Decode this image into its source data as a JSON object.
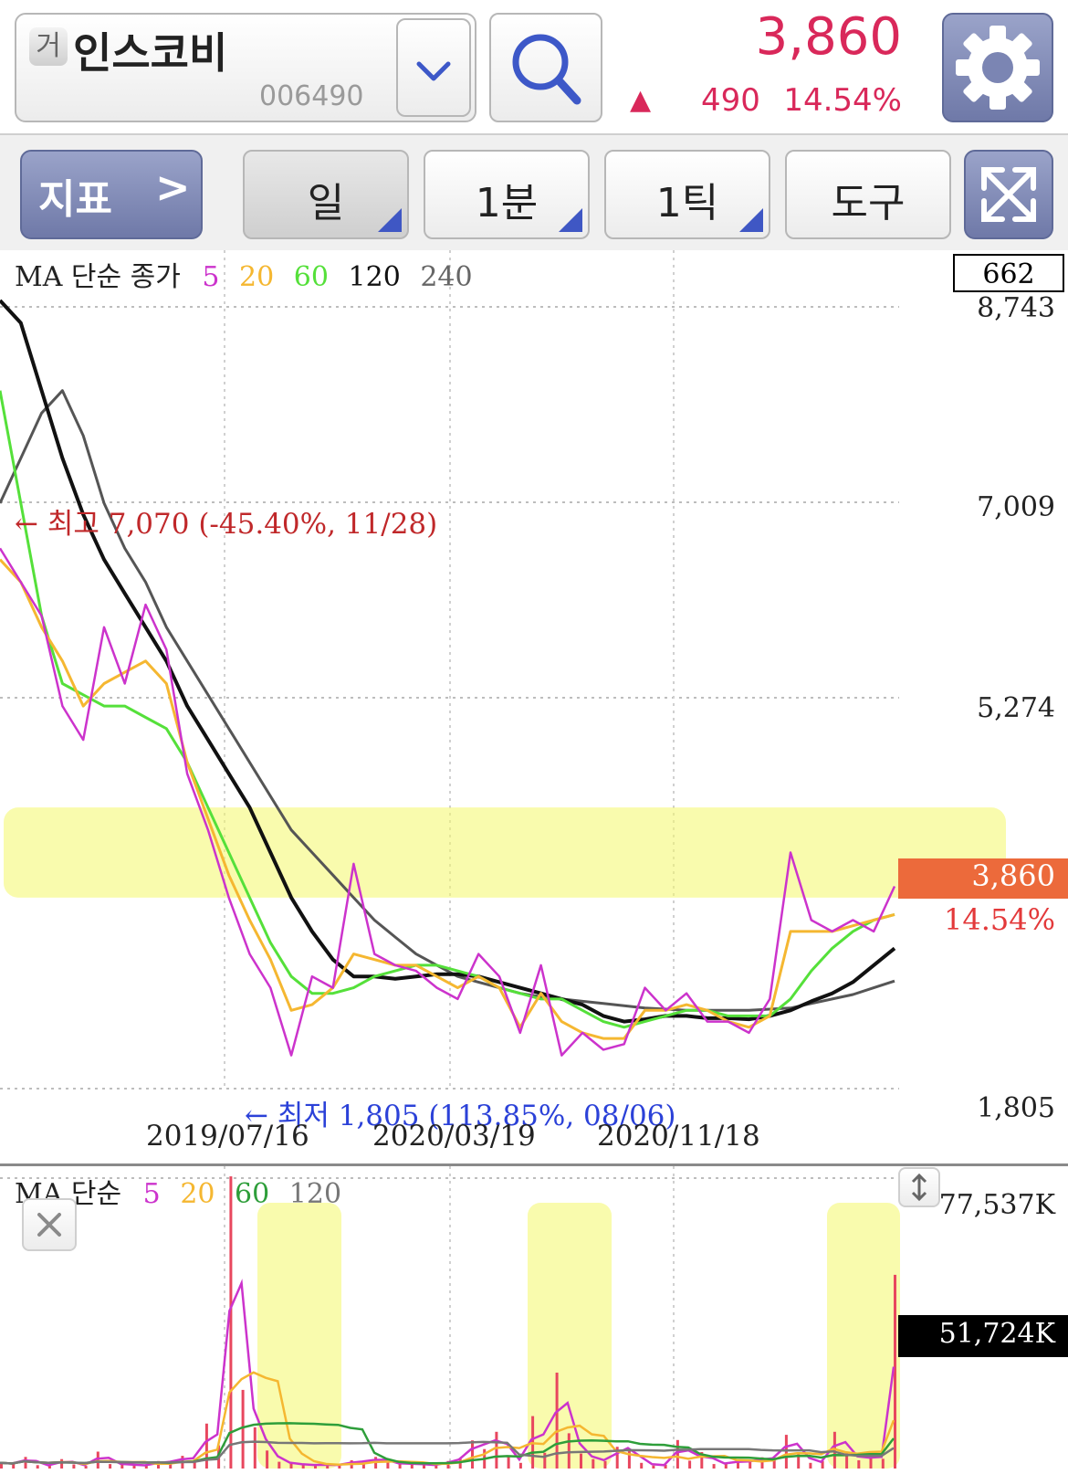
{
  "header": {
    "market_badge": "거",
    "stock_name": "인스코비",
    "stock_code": "006490",
    "price": "3,860",
    "change_arrow": "▲",
    "change": "490",
    "change_pct": "14.54%"
  },
  "toolbar": {
    "indicator_label": "지표",
    "indicator_chevron": ">",
    "period_day": "일",
    "period_minute": "1분",
    "period_tick": "1틱",
    "tools_label": "도구"
  },
  "icons": {
    "dropdown": "chevron-down-icon",
    "search": "search-icon",
    "settings": "gear-icon",
    "expand": "expand-icon",
    "close": "close-icon",
    "resize": "resize-icon"
  },
  "colors": {
    "up": "#d9285a",
    "ma5": "#cc33cc",
    "ma20": "#f5b731",
    "ma60": "#55e03a",
    "ma120": "#111111",
    "ma240": "#555555",
    "vol_ma60": "#2e9e3a",
    "vol_ma120": "#777777",
    "price_tag": "#ec6a3b",
    "highlight": "#f4f86a",
    "high_note": "#c0282a",
    "low_note": "#2b41d8"
  },
  "chart_data": [
    {
      "type": "line",
      "legend": {
        "prefix": "MA 단순 종가",
        "periods": [
          "5",
          "20",
          "60",
          "120",
          "240"
        ]
      },
      "x_tick_labels": [
        "2019/07/16",
        "2020/03/19",
        "2020/11/18"
      ],
      "y_tick_labels": [
        "8,743",
        "7,009",
        "5,274",
        "1,805"
      ],
      "ylim": [
        1805,
        8743
      ],
      "top_box_label": "662",
      "current_price_label": "3,860",
      "current_change_label": "14.54%",
      "annotations": {
        "high": "← 최고 7,070 (-45.40%, 11/28)",
        "low": "← 최저 1,805 (113.85%, 08/06)"
      },
      "highlight_band_price": [
        3500,
        4300
      ],
      "series": [
        {
          "name": "5",
          "values": [
            6600,
            6300,
            6000,
            5200,
            4900,
            5900,
            5400,
            6100,
            5700,
            4600,
            4100,
            3500,
            3000,
            2700,
            2100,
            2800,
            2700,
            3800,
            3000,
            2900,
            2850,
            2700,
            2600,
            3000,
            2800,
            2300,
            2900,
            2100,
            2300,
            2150,
            2200,
            2700,
            2500,
            2650,
            2400,
            2400,
            2300,
            2600,
            3900,
            3300,
            3200,
            3300,
            3200,
            3600
          ]
        },
        {
          "name": "20",
          "values": [
            6500,
            6300,
            5900,
            5600,
            5200,
            5400,
            5500,
            5600,
            5400,
            4700,
            4200,
            3700,
            3300,
            2950,
            2500,
            2550,
            2700,
            3000,
            2950,
            2900,
            2900,
            2800,
            2700,
            2800,
            2700,
            2350,
            2650,
            2400,
            2300,
            2250,
            2250,
            2500,
            2500,
            2550,
            2500,
            2400,
            2350,
            2450,
            3200,
            3200,
            3200,
            3250,
            3300,
            3350
          ]
        },
        {
          "name": "60",
          "values": [
            8000,
            7000,
            6000,
            5400,
            5300,
            5200,
            5200,
            5100,
            5000,
            4700,
            4300,
            3900,
            3500,
            3100,
            2800,
            2650,
            2650,
            2700,
            2800,
            2850,
            2900,
            2900,
            2850,
            2800,
            2700,
            2650,
            2600,
            2600,
            2500,
            2400,
            2350,
            2400,
            2450,
            2500,
            2500,
            2450,
            2450,
            2450,
            2600,
            2850,
            3050,
            3200,
            3300,
            3350
          ]
        },
        {
          "name": "120",
          "values": [
            8800,
            8600,
            8000,
            7400,
            6900,
            6500,
            6200,
            5900,
            5600,
            5200,
            4900,
            4600,
            4300,
            3900,
            3500,
            3200,
            2950,
            2800,
            2800,
            2780,
            2800,
            2820,
            2820,
            2800,
            2750,
            2700,
            2650,
            2600,
            2550,
            2450,
            2400,
            2420,
            2450,
            2450,
            2430,
            2430,
            2420,
            2450,
            2500,
            2580,
            2650,
            2750,
            2900,
            3050
          ]
        },
        {
          "name": "240",
          "values": [
            7000,
            7400,
            7800,
            8000,
            7600,
            7000,
            6600,
            6300,
            5900,
            5600,
            5300,
            5000,
            4700,
            4400,
            4100,
            3900,
            3700,
            3500,
            3300,
            3150,
            3000,
            2900,
            2800,
            2750,
            2700,
            2650,
            2620,
            2600,
            2580,
            2560,
            2540,
            2520,
            2510,
            2500,
            2500,
            2500,
            2500,
            2510,
            2520,
            2560,
            2600,
            2640,
            2700,
            2760
          ]
        }
      ]
    },
    {
      "type": "bar",
      "legend": {
        "prefix": "MA 단순",
        "periods": [
          "5",
          "20",
          "60",
          "120"
        ]
      },
      "y_tick_labels": [
        "77,537K"
      ],
      "ylim": [
        0,
        77537
      ],
      "current_volume_label": "51,724K",
      "series": [
        {
          "name": "volume",
          "values": [
            1500,
            1200,
            3100,
            900,
            800,
            2500,
            1100,
            700,
            4500,
            1200,
            1300,
            800,
            900,
            2000,
            1500,
            3400,
            2100,
            12000,
            6200,
            78000,
            21000,
            11000,
            4800,
            1800,
            1300,
            1000,
            900,
            1100,
            800,
            2200,
            1500,
            3100,
            1600,
            1200,
            1400,
            900,
            1000,
            2000,
            2800,
            7500,
            5200,
            9800,
            3300,
            1500,
            14000,
            4200,
            25600,
            9400,
            4000,
            2500,
            2000,
            5800,
            5100,
            1500,
            800,
            1000,
            7600,
            2100,
            4400,
            1200,
            1500,
            2000,
            1800,
            3000,
            2500,
            9000,
            4200,
            1500,
            2000,
            9800,
            4300,
            2200,
            3600,
            2600,
            51724
          ]
        }
      ]
    }
  ]
}
